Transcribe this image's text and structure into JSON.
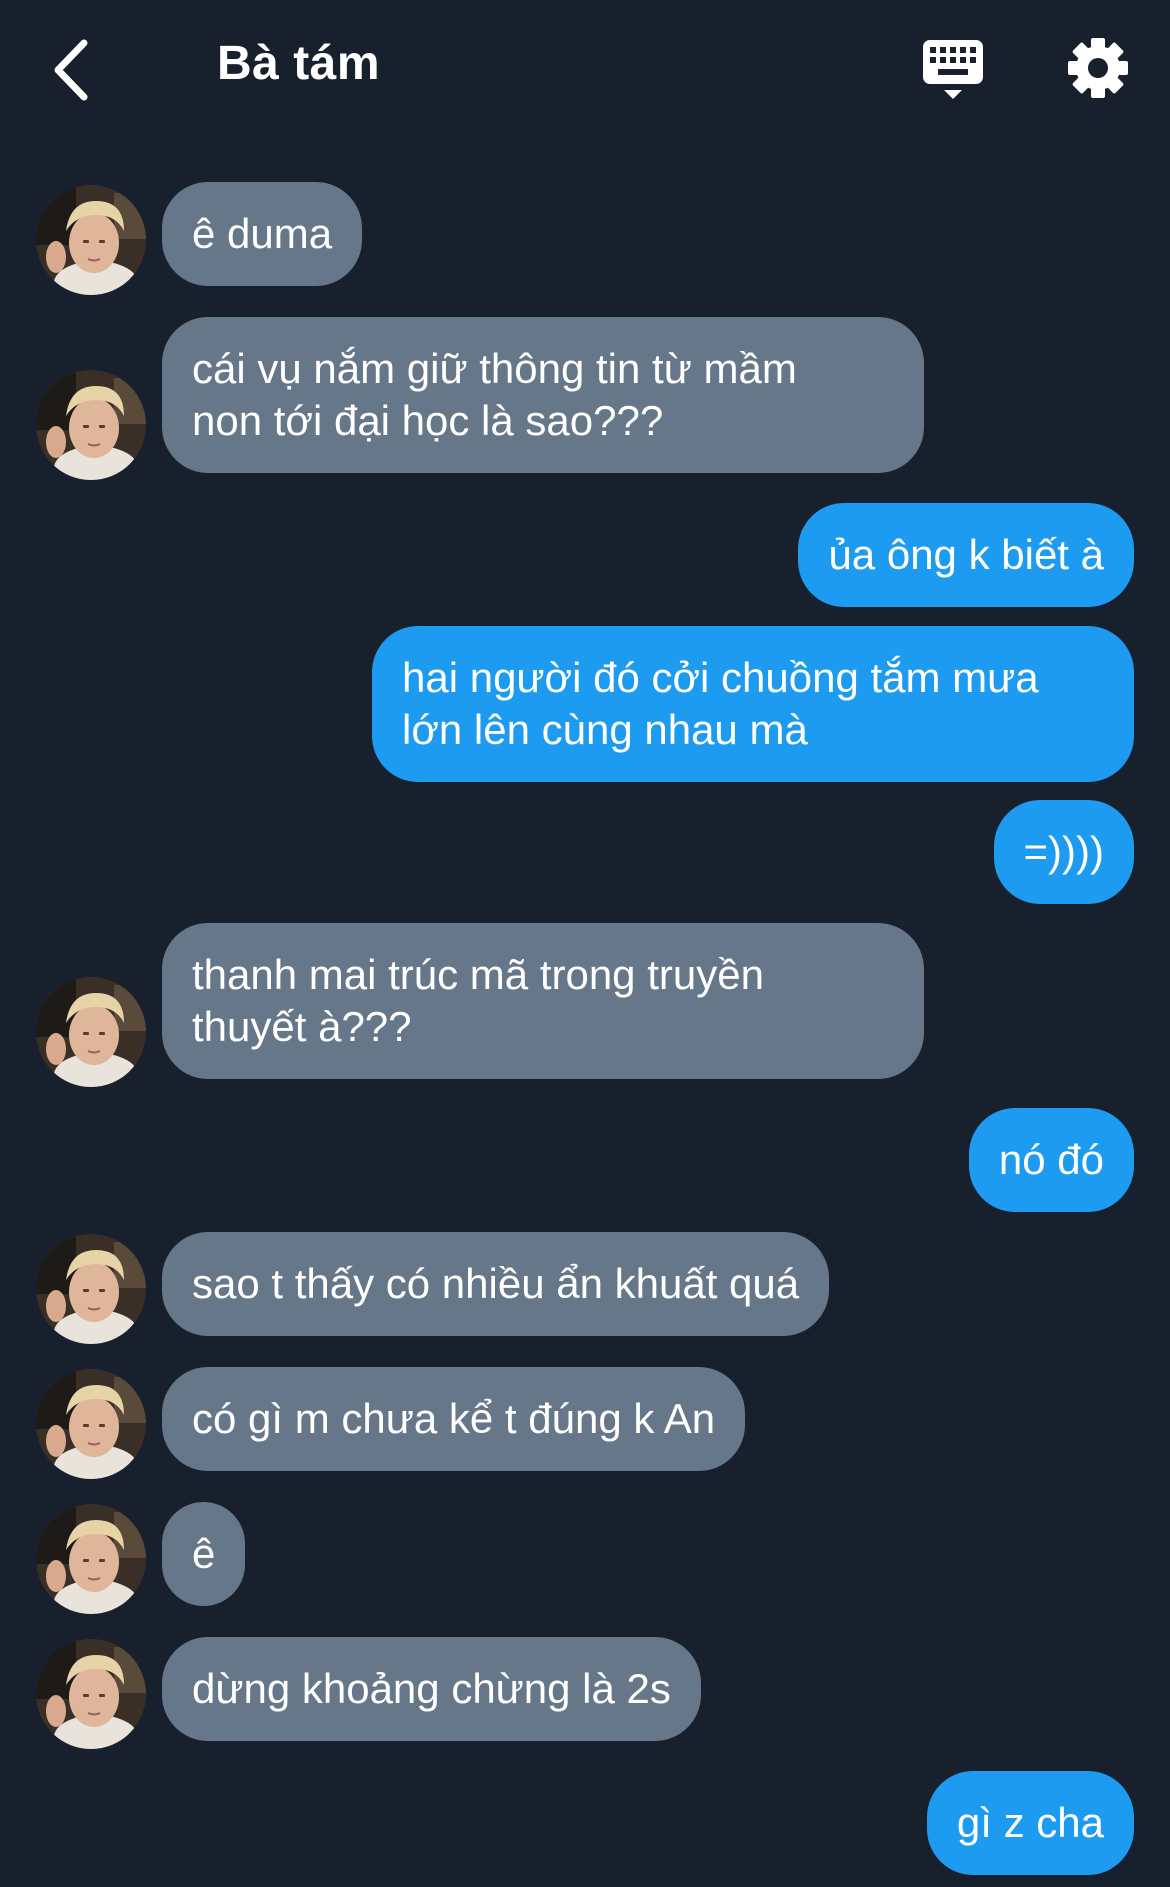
{
  "header": {
    "title": "Bà tám",
    "back_icon": "chevron-left-icon",
    "keyboard_icon": "keyboard-icon",
    "settings_icon": "gear-icon"
  },
  "colors": {
    "background": "#17202c",
    "incoming_bubble": "#66778a",
    "outgoing_bubble": "#1d9bf0"
  },
  "messages": [
    {
      "from": "them",
      "lines": [
        "ê duma"
      ]
    },
    {
      "from": "them",
      "lines": [
        "cái vụ nắm giữ thông tin từ mầm",
        "non tới đại học là sao???"
      ]
    },
    {
      "from": "me",
      "lines": [
        "ủa ông k biết à"
      ]
    },
    {
      "from": "me",
      "lines": [
        "hai người đó cởi chuồng tắm mưa",
        "lớn lên cùng nhau mà"
      ]
    },
    {
      "from": "me",
      "lines": [
        "=))))"
      ]
    },
    {
      "from": "them",
      "lines": [
        "thanh mai trúc mã trong truyền",
        "thuyết à???"
      ]
    },
    {
      "from": "me",
      "lines": [
        "nó đó"
      ]
    },
    {
      "from": "them",
      "lines": [
        "sao t thấy có nhiều ẩn khuất quá"
      ]
    },
    {
      "from": "them",
      "lines": [
        "có gì m chưa kể t đúng k An"
      ]
    },
    {
      "from": "them",
      "lines": [
        "ê"
      ]
    },
    {
      "from": "them",
      "lines": [
        "dừng khoảng chừng là 2s"
      ]
    },
    {
      "from": "me",
      "lines": [
        "gì z cha"
      ]
    }
  ]
}
